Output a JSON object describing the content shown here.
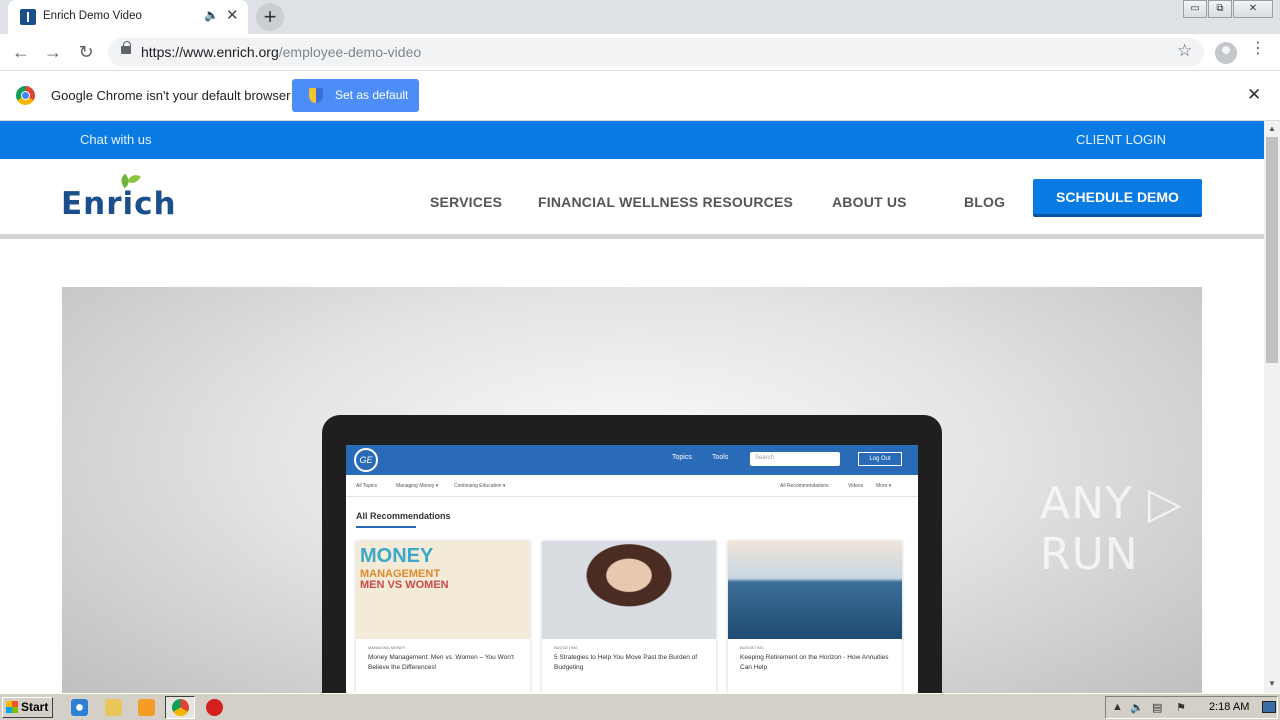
{
  "browser": {
    "tab": {
      "title": "Enrich Demo Video",
      "audio_icon": "🔈",
      "close_icon": "✕"
    },
    "new_tab_icon": "+",
    "window_controls": {
      "minimize": "▭",
      "restore": "⧉",
      "close": "✕"
    },
    "nav": {
      "back": "←",
      "forward": "→",
      "reload": "↻"
    },
    "url_domain": "https://www.enrich.org",
    "url_path": "/employee-demo-video",
    "star_icon": "☆",
    "menu_icon": "⋮"
  },
  "infobar": {
    "message": "Google Chrome isn't your default browser",
    "button": "Set as default",
    "close_icon": "✕"
  },
  "site": {
    "topbar": {
      "chat": "Chat with us",
      "client_login": "CLIENT LOGIN"
    },
    "logo": "Enrich",
    "nav": [
      "SERVICES",
      "FINANCIAL WELLNESS RESOURCES",
      "ABOUT US",
      "BLOG"
    ],
    "cta": "SCHEDULE DEMO",
    "video": {
      "screen": {
        "ge": "GE",
        "tabs": [
          "Topics",
          "Tools"
        ],
        "search_placeholder": "Search",
        "logout": "Log Out",
        "subnav": [
          "All Topics",
          "Managing Money ▾",
          "Continuing Education ▾",
          "All Recommendations",
          "Videos",
          "More ▾"
        ],
        "heading": "All Recommendations",
        "cards": [
          {
            "cat": "MANAGING MONEY",
            "title": "Money Management: Men vs. Women – You Won't Believe the Differences!",
            "img1": "MONEY",
            "img2": "MANAGEMENT",
            "img3": "MEN VS WOMEN"
          },
          {
            "cat": "BUDGETING",
            "title": "5 Strategies to Help You Move Past the Burden of Budgeting"
          },
          {
            "cat": "BUDGETING",
            "title": "Keeping Retirement on the Horizon - How Annuities Can Help"
          }
        ]
      }
    },
    "watermark": "ANY ▷ RUN"
  },
  "taskbar": {
    "start": "Start",
    "clock": "2:18 AM"
  },
  "colors": {
    "brand_blue": "#0a7be3",
    "logo_blue": "#1a4f8c",
    "leaf_green": "#6cb33f",
    "chrome_blue": "#4d8df7"
  }
}
